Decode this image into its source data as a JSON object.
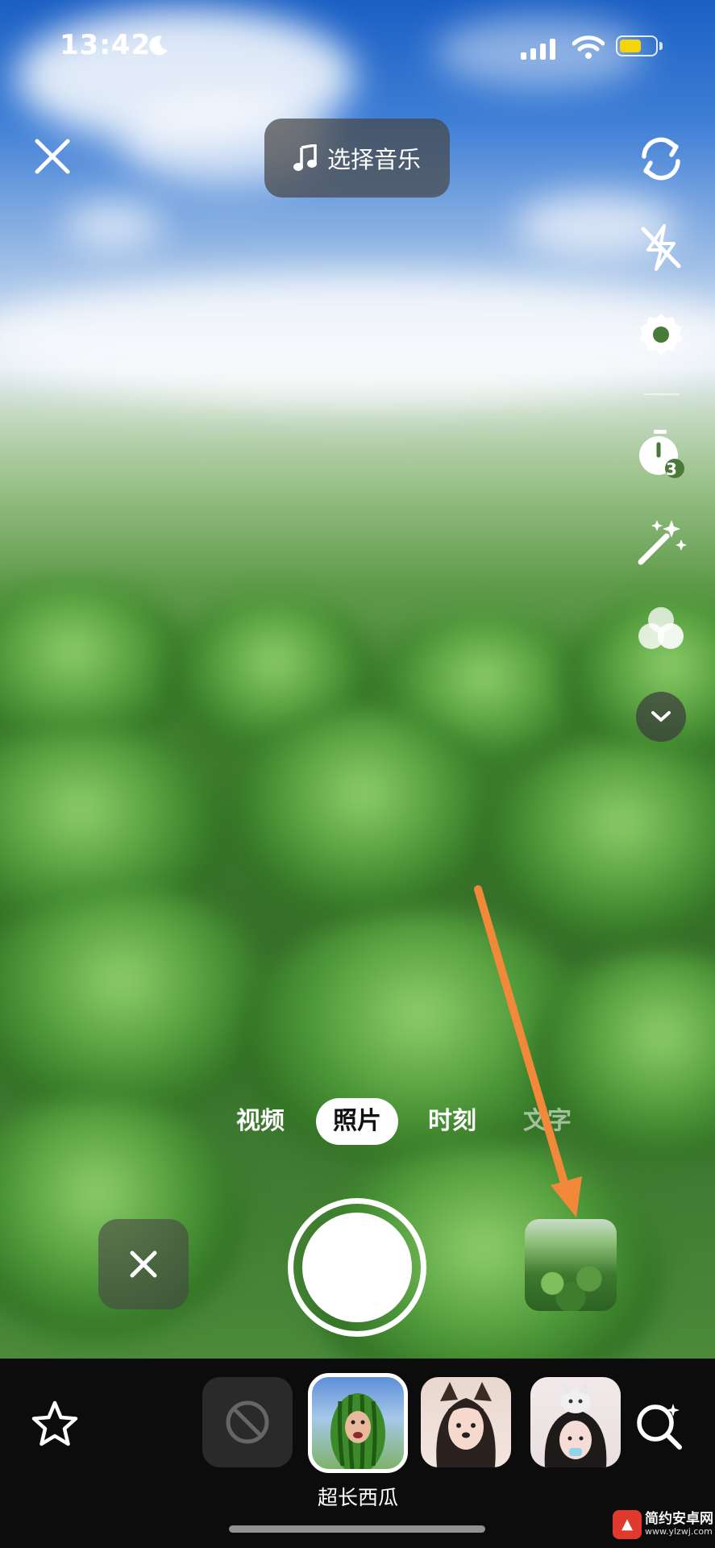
{
  "status_bar": {
    "time": "13:42",
    "battery_color": "#f6d40a"
  },
  "top_bar": {
    "music_label": "选择音乐"
  },
  "side_toolbar": {
    "icons": [
      "flip-camera-icon",
      "flash-off-icon",
      "settings-gear-icon",
      "timer-icon",
      "magic-wand-icon",
      "filter-circles-icon",
      "chevron-down-icon"
    ],
    "timer_value": "3"
  },
  "modes": [
    {
      "label": "视频",
      "active": false
    },
    {
      "label": "照片",
      "active": true
    },
    {
      "label": "时刻",
      "active": false
    },
    {
      "label": "文字",
      "active": false
    }
  ],
  "effects": {
    "selected_label": "超长西瓜",
    "items": [
      "none-effect",
      "watermelon-effect",
      "dog-ears-effect",
      "cat-effect"
    ]
  },
  "annotation": {
    "arrow_color": "#f2883a"
  },
  "watermark": {
    "text": "简约安卓网",
    "url": "www.ylzwj.com"
  }
}
